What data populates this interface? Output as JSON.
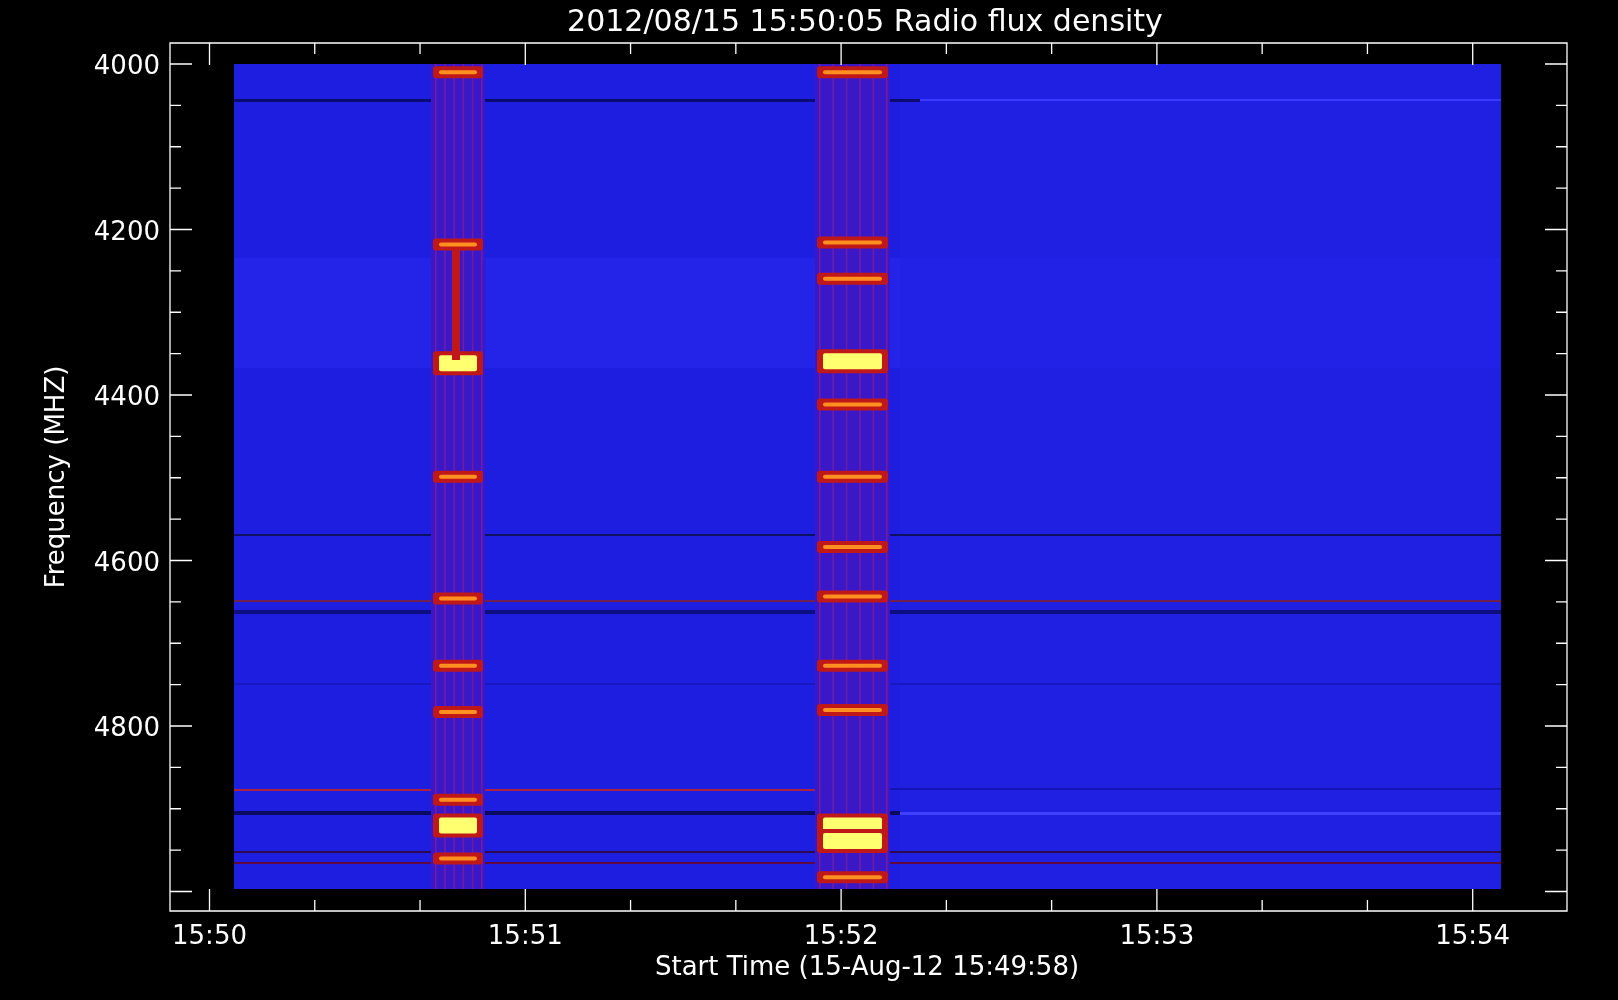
{
  "plot": {
    "title": "2012/08/15 15:50:05 Radio flux density",
    "xlabel": "Start Time (15-Aug-12 15:49:58)",
    "ylabel": "Frequency (MHZ)",
    "xtick_labels": [
      "15:50",
      "15:51",
      "15:52",
      "15:53",
      "15:54"
    ],
    "ytick_labels": [
      "4000",
      "4200",
      "4400",
      "4600",
      "4800"
    ]
  }
}
